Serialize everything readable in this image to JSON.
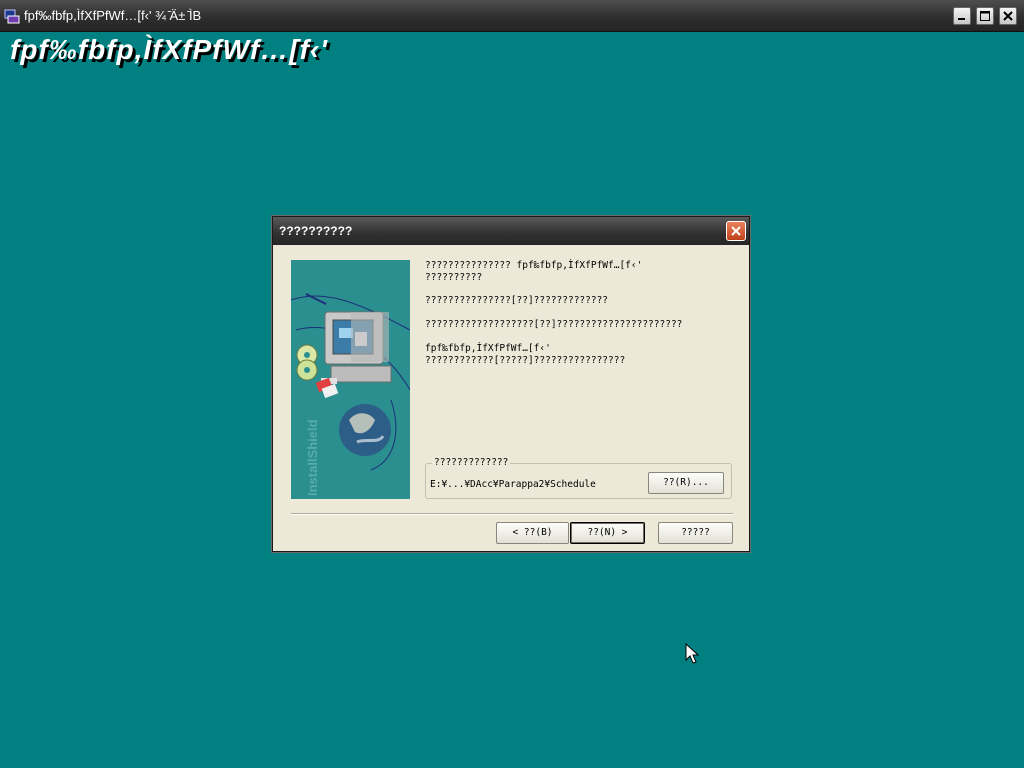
{
  "window": {
    "title": "fpf‰fbfp,ÌfXfPfWf…[f‹' ¾ ̄Ä± ̄ÌB"
  },
  "installer": {
    "heading": "fpf‰fbfp,ÌfXfPfWf…[f‹'"
  },
  "dialog": {
    "title": "??????????",
    "messages": {
      "line1a": "??????????????? fpf‰fbfp,ÌfXfPfWf…[f‹'",
      "line1b": "??????????",
      "line2": "???????????????[??]?????????????",
      "line3": "???????????????????[??]??????????????????????",
      "line4a": "fpf‰fbfp,ÌfXfPfWf…[f‹'",
      "line4b": "????????????[?????]????????????????"
    },
    "destination": {
      "legend": "?????????????",
      "path": "E:¥...¥DAcc¥Parappa2¥Schedule",
      "browse_label": "??(R)..."
    },
    "buttons": {
      "back": "< ??(B)",
      "next": "??(N) >",
      "cancel": "?????"
    }
  }
}
